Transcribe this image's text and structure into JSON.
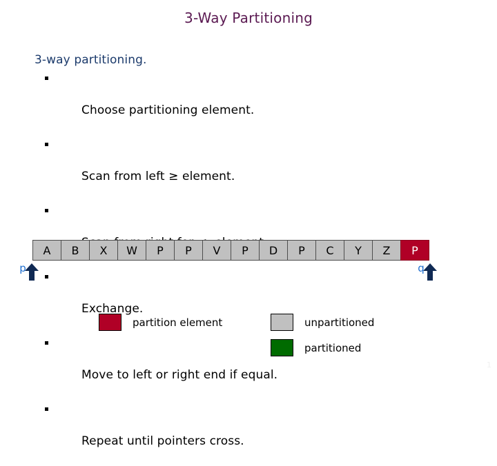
{
  "slide": {
    "title": "3-Way Partitioning",
    "page_number": "1",
    "title_color": "#5B1A52"
  },
  "body": {
    "heading": "3-way partitioning.",
    "heading_color": "#1B3A6B",
    "bullets": [
      "Choose partitioning element.",
      "Scan from left ≥ element.",
      "Scan from right for ≤  element.",
      "Exchange.",
      "Move to left or right end if equal.",
      "Repeat until pointers cross."
    ]
  },
  "array": {
    "cells": [
      {
        "value": "A",
        "state": "unpartitioned"
      },
      {
        "value": "B",
        "state": "unpartitioned"
      },
      {
        "value": "X",
        "state": "unpartitioned"
      },
      {
        "value": "W",
        "state": "unpartitioned"
      },
      {
        "value": "P",
        "state": "unpartitioned"
      },
      {
        "value": "P",
        "state": "unpartitioned"
      },
      {
        "value": "V",
        "state": "unpartitioned"
      },
      {
        "value": "P",
        "state": "unpartitioned"
      },
      {
        "value": "D",
        "state": "unpartitioned"
      },
      {
        "value": "P",
        "state": "unpartitioned"
      },
      {
        "value": "C",
        "state": "unpartitioned"
      },
      {
        "value": "Y",
        "state": "unpartitioned"
      },
      {
        "value": "Z",
        "state": "unpartitioned"
      },
      {
        "value": "P",
        "state": "pivot"
      }
    ]
  },
  "pointers": {
    "left": {
      "label": "p",
      "icon": "arrow-up-icon",
      "color": "#1F6FD0"
    },
    "right": {
      "label": "q",
      "icon": "arrow-up-icon",
      "color": "#1F6FD0"
    }
  },
  "legend": {
    "pivot": {
      "label": "partition element",
      "color": "#B00026"
    },
    "unpartitioned": {
      "label": "unpartitioned",
      "color": "#C0C0C0"
    },
    "partitioned": {
      "label": "partitioned",
      "color": "#006B00"
    }
  }
}
